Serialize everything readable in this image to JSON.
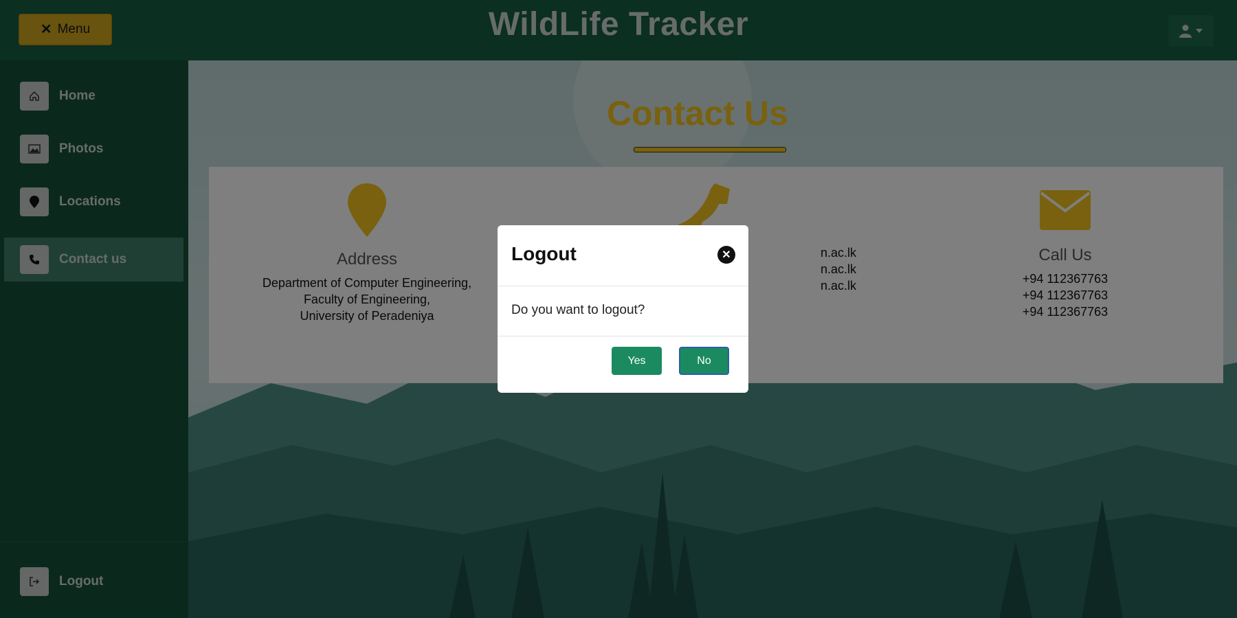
{
  "header": {
    "menu_label": "Menu",
    "menu_icon": "close-icon",
    "app_title": "WildLife Tracker",
    "user_icon": "user-icon"
  },
  "sidebar": {
    "items": [
      {
        "label": "Home",
        "icon": "home-icon"
      },
      {
        "label": "Photos",
        "icon": "image-icon"
      },
      {
        "label": "Locations",
        "icon": "map-pin-icon"
      },
      {
        "label": "Contact us",
        "icon": "phone-icon",
        "active": true
      }
    ],
    "logout": {
      "label": "Logout",
      "icon": "logout-icon"
    }
  },
  "main": {
    "title": "Contact Us",
    "columns": [
      {
        "title": "Address",
        "icon": "map-pin-icon",
        "lines": [
          "Department of Computer Engineering,",
          "Faculty of Engineering,",
          "University of Peradeniya"
        ]
      },
      {
        "title": "",
        "icon": "phone-icon",
        "lines": [
          "n.ac.lk",
          "n.ac.lk",
          "n.ac.lk"
        ]
      },
      {
        "title": "Call Us",
        "icon": "envelope-icon",
        "lines": [
          "+94 112367763",
          "+94 112367763",
          "+94 112367763"
        ]
      }
    ]
  },
  "modal": {
    "title": "Logout",
    "message": "Do you want to logout?",
    "yes_label": "Yes",
    "no_label": "No"
  },
  "colors": {
    "header_bg": "#165f43",
    "sidebar_bg": "#17513b",
    "accent_gold": "#f2c21f",
    "button_green": "#1c8a61"
  }
}
